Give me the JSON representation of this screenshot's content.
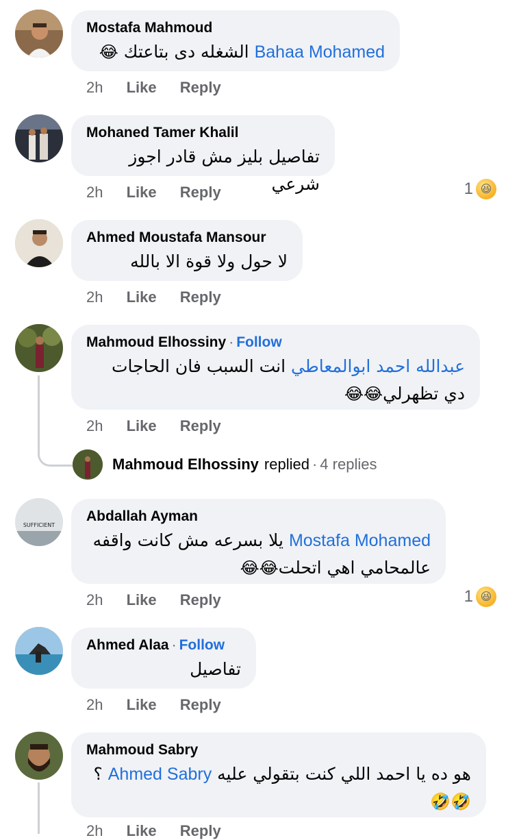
{
  "comments": [
    {
      "name": "Mostafa Mahmoud",
      "follow": "",
      "mention": "Bahaa Mohamed",
      "text": "الشغله دى بتاعتك",
      "emoji": "😂",
      "time": "2h",
      "like": "Like",
      "reply": "Reply",
      "reaction_count": ""
    },
    {
      "name": "Mohaned Tamer Khalil",
      "follow": "",
      "mention": "",
      "text": "تفاصيل بليز مش قادر اجوز شرعي",
      "emoji": "",
      "time": "2h",
      "like": "Like",
      "reply": "Reply",
      "reaction_count": "1"
    },
    {
      "name": "Ahmed Moustafa Mansour",
      "follow": "",
      "mention": "",
      "text": "لا حول ولا قوة الا بالله",
      "emoji": "",
      "time": "2h",
      "like": "Like",
      "reply": "Reply",
      "reaction_count": ""
    },
    {
      "name": "Mahmoud Elhossiny",
      "follow": "Follow",
      "mention": "عبدالله احمد ابوالمعاطي",
      "text": "انت السبب فان الحاجات دي تظهرلي",
      "emoji": "😂😂",
      "time": "2h",
      "like": "Like",
      "reply": "Reply",
      "reaction_count": ""
    },
    {
      "name": "Abdallah Ayman",
      "follow": "",
      "mention": "Mostafa Mohamed",
      "text": "يلا بسرعه مش كانت واقفه عالمحامي اهي اتحلت",
      "emoji": "😂😂",
      "time": "2h",
      "like": "Like",
      "reply": "Reply",
      "reaction_count": "1"
    },
    {
      "name": "Ahmed Alaa",
      "follow": "Follow",
      "mention": "",
      "text": "تفاصيل",
      "emoji": "",
      "time": "2h",
      "like": "Like",
      "reply": "Reply",
      "reaction_count": ""
    },
    {
      "name": "Mahmoud Sabry",
      "follow": "",
      "mention": "Ahmed Sabry",
      "text": "هو ده يا احمد اللي كنت بتقولي عليه",
      "trailing": "؟",
      "emoji": "🤣🤣",
      "time": "2h",
      "like": "Like",
      "reply": "Reply",
      "reaction_count": ""
    }
  ],
  "replies_summary": {
    "name": "Mahmoud Elhossiny",
    "verb": "replied",
    "count": "4 replies"
  },
  "separator": "·",
  "avatar_text": {
    "abdallah": "SUFFICIENT"
  },
  "colors": {
    "bubble": "#f0f2f5",
    "link": "#216fdb",
    "meta": "#65676b"
  }
}
